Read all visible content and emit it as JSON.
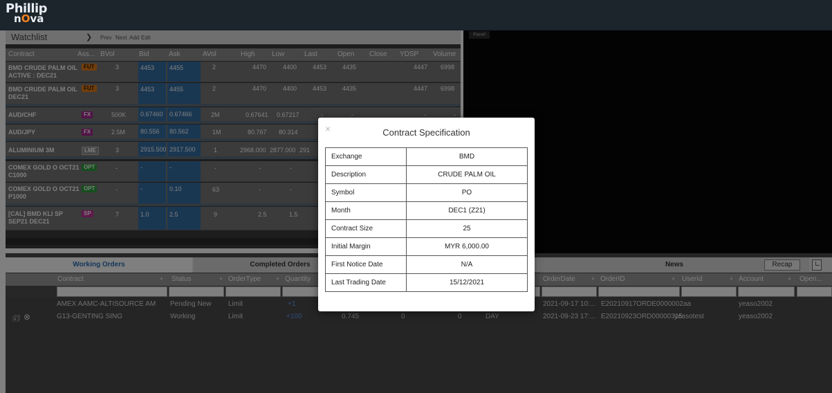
{
  "app": {
    "logo_line1": "Phillip",
    "logo_line2a": "n",
    "logo_line2b": "O",
    "logo_line2c": "va"
  },
  "watchlist": {
    "title": "Watchlist",
    "toolbar": {
      "prev": "Prev",
      "next": "Next",
      "add": "Add",
      "edit": "Edit"
    },
    "columns": [
      "Contract",
      "Ass...",
      "BVol",
      "Bid",
      "Ask",
      "AVol",
      "High",
      "Low",
      "Last",
      "Open",
      "Close",
      "YDSP",
      "Volume"
    ],
    "rows": [
      {
        "contract": "BMD CRUDE PALM OIL ACTIVE : DEC21",
        "asset": "FUT",
        "bvol": "3",
        "bid": "4453",
        "ask": "4455",
        "avol": "2",
        "high": "4470",
        "low": "4400",
        "last": "4453",
        "open": "4435",
        "close": "",
        "ydsp": "4447",
        "volume": "6998"
      },
      {
        "contract": "BMD CRUDE PALM OIL DEC21",
        "asset": "FUT",
        "bvol": "3",
        "bid": "4453",
        "ask": "4455",
        "avol": "2",
        "high": "4470",
        "low": "4400",
        "last": "4453",
        "open": "4435",
        "close": "",
        "ydsp": "4447",
        "volume": "6998"
      },
      {
        "contract": "AUD/CHF",
        "asset": "FX",
        "bvol": "500K",
        "bid": "0.67460",
        "ask": "0.67466",
        "avol": "2M",
        "high": "0.67641",
        "low": "0.67217",
        "last": "-",
        "open": "-",
        "close": "",
        "ydsp": "-",
        "volume": "-"
      },
      {
        "contract": "AUD/JPY",
        "asset": "FX",
        "bvol": "2.5M",
        "bid": "80.556",
        "ask": "80.562",
        "avol": "1M",
        "high": "80.767",
        "low": "80.314",
        "last": "",
        "open": "",
        "close": "",
        "ydsp": "",
        "volume": ""
      },
      {
        "contract": "ALUMINIUM 3M",
        "asset": "LME",
        "bvol": "3",
        "bid": "2915.500",
        "ask": "2917.500",
        "avol": "1",
        "high": "2968.000",
        "low": "2877.000",
        "last": "291",
        "open": "",
        "close": "",
        "ydsp": "",
        "volume": ""
      },
      {
        "contract": "COMEX GOLD O OCT21 C1000",
        "asset": "OPT",
        "bvol": "-",
        "bid": "-",
        "ask": "-",
        "avol": "-",
        "high": "-",
        "low": "-",
        "last": "",
        "open": "",
        "close": "",
        "ydsp": "",
        "volume": ""
      },
      {
        "contract": "COMEX GOLD O OCT21 P1000",
        "asset": "OPT",
        "bvol": "-",
        "bid": "-",
        "ask": "0.10",
        "avol": "63",
        "high": "-",
        "low": "-",
        "last": "",
        "open": "",
        "close": "",
        "ydsp": "",
        "volume": ""
      },
      {
        "contract": "[CAL] BMD KLI SP SEP21 DEC21",
        "asset": "SP",
        "bvol": "7",
        "bid": "1.0",
        "ask": "2.5",
        "avol": "9",
        "high": "2.5",
        "low": "1.5",
        "last": "1",
        "open": "",
        "close": "",
        "ydsp": "",
        "volume": ""
      }
    ]
  },
  "panel": {
    "tab": "Panel"
  },
  "orders": {
    "tabs": {
      "working": "Working Orders",
      "completed": "Completed Orders",
      "news": "News",
      "recap": "Recap"
    },
    "columns_left": [
      "Contract",
      "Status",
      "OrderType",
      "Quantity"
    ],
    "columns_right": [
      "OrderDate",
      "OrderID",
      "UserId",
      "Account",
      "Open..."
    ],
    "rows": [
      {
        "contract": "AMEX AAMC-ALTISOURCE AM",
        "status": "Pending New",
        "type": "Limit",
        "qty": "+1",
        "price": "",
        "filled": "",
        "remaining": "",
        "tif": "",
        "date": "2021-09-17 10:...",
        "id": "E20210917ORDE0000002",
        "user": "aa",
        "account": "yeaso2002"
      },
      {
        "contract": "G13-GENTING SING",
        "status": "Working",
        "type": "Limit",
        "qty": "+100",
        "price": "0.745",
        "filled": "0",
        "remaining": "0",
        "tif": "DAY",
        "date": "2021-09-23 17:...",
        "id": "E20210923ORD00000315",
        "user": "yeasotest",
        "account": "yeaso2002"
      }
    ]
  },
  "modal": {
    "close": "×",
    "title": "Contract Specification",
    "rows": [
      {
        "label": "Exchange",
        "value": "BMD"
      },
      {
        "label": "Description",
        "value": "CRUDE PALM OIL"
      },
      {
        "label": "Symbol",
        "value": "PO"
      },
      {
        "label": "Month",
        "value": "DEC1 (Z21)"
      },
      {
        "label": "Contract Size",
        "value": "25"
      },
      {
        "label": "Initial Margin",
        "value": "MYR 6,000.00"
      },
      {
        "label": "First Notice Date",
        "value": "N/A"
      },
      {
        "label": "Last Trading Date",
        "value": "15/12/2021"
      }
    ]
  },
  "colors": {
    "fut": "#e07b1a",
    "fx": "#a4258f",
    "lme": "#8e8e8e",
    "opt": "#2a9d3a",
    "sp": "#c0309a",
    "bid": "#356fa5",
    "accent": "#2a6fb5"
  }
}
